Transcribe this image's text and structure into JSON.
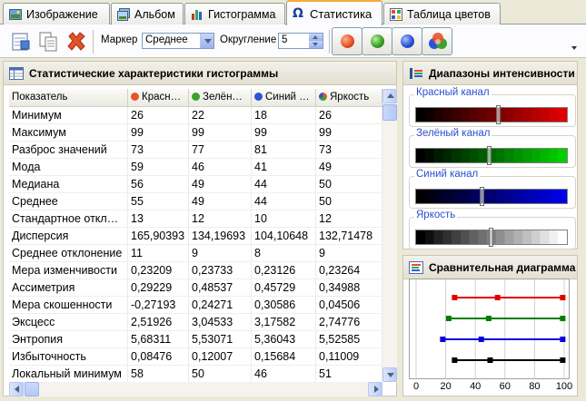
{
  "tabs": [
    {
      "label": "Изображение",
      "icon": "image-icon"
    },
    {
      "label": "Альбом",
      "icon": "album-icon"
    },
    {
      "label": "Гистограмма",
      "icon": "histogram-icon"
    },
    {
      "label": "Статистика",
      "icon": "omega-icon",
      "active": true
    },
    {
      "label": "Таблица цветов",
      "icon": "color-table-icon"
    }
  ],
  "toolbar": {
    "marker_label": "Маркер",
    "marker_value": "Среднее",
    "rounding_label": "Округление",
    "rounding_value": "5"
  },
  "stats_panel": {
    "title": "Статистические характеристики гистограммы",
    "columns": [
      {
        "label": "Показатель"
      },
      {
        "label": "Красн…",
        "color": "#e8542a"
      },
      {
        "label": "Зелён…",
        "color": "#3aa32a"
      },
      {
        "label": "Синий …",
        "color": "#2a54d8"
      },
      {
        "label": "Яркость",
        "color": "#9a9a9a"
      }
    ],
    "rows": [
      [
        "Минимум",
        "26",
        "22",
        "18",
        "26"
      ],
      [
        "Максимум",
        "99",
        "99",
        "99",
        "99"
      ],
      [
        "Разброс значений",
        "73",
        "77",
        "81",
        "73"
      ],
      [
        "Мода",
        "59",
        "46",
        "41",
        "49"
      ],
      [
        "Медиана",
        "56",
        "49",
        "44",
        "50"
      ],
      [
        "Среднее",
        "55",
        "49",
        "44",
        "50"
      ],
      [
        "Стандартное откл…",
        "13",
        "12",
        "10",
        "12"
      ],
      [
        "Дисперсия",
        "165,90393",
        "134,19693",
        "104,10648",
        "132,71478"
      ],
      [
        "Среднее отклонение",
        "11",
        "9",
        "8",
        "9"
      ],
      [
        "Мера изменчивости",
        "0,23209",
        "0,23733",
        "0,23126",
        "0,23264"
      ],
      [
        "Ассиметрия",
        "0,29229",
        "0,48537",
        "0,45729",
        "0,34988"
      ],
      [
        "Мера скошенности",
        "-0,27193",
        "0,24271",
        "0,30586",
        "0,04506"
      ],
      [
        "Эксцесс",
        "2,51926",
        "3,04533",
        "3,17582",
        "2,74776"
      ],
      [
        "Энтропия",
        "5,68311",
        "5,53071",
        "5,36043",
        "5,52585"
      ],
      [
        "Избыточность",
        "0,08476",
        "0,12007",
        "0,15684",
        "0,11009"
      ],
      [
        "Локальный минимум",
        "58",
        "50",
        "46",
        "51"
      ]
    ]
  },
  "ranges_panel": {
    "title": "Диапазоны интенсивности",
    "channels": [
      {
        "label": "Красный канал",
        "color": "#e00000",
        "marker_fraction": 0.55
      },
      {
        "label": "Зелёный канал",
        "color": "#00d000",
        "marker_fraction": 0.49
      },
      {
        "label": "Синий канал",
        "color": "#0000e8",
        "marker_fraction": 0.44
      },
      {
        "label": "Яркость",
        "color": "#ffffff",
        "marker_fraction": 0.5
      }
    ]
  },
  "compare_panel": {
    "title": "Сравнительная диаграмма"
  },
  "chart_data": {
    "type": "range",
    "xlim": [
      0,
      100
    ],
    "x_ticks": [
      "0",
      "20",
      "40",
      "60",
      "80",
      "100"
    ],
    "series": [
      {
        "color": "#e00000",
        "min": 26,
        "mean": 55,
        "max": 99
      },
      {
        "color": "#008000",
        "min": 22,
        "mean": 49,
        "max": 99
      },
      {
        "color": "#0000e0",
        "min": 18,
        "mean": 44,
        "max": 99
      },
      {
        "color": "#000000",
        "min": 26,
        "mean": 50,
        "max": 99
      }
    ]
  }
}
